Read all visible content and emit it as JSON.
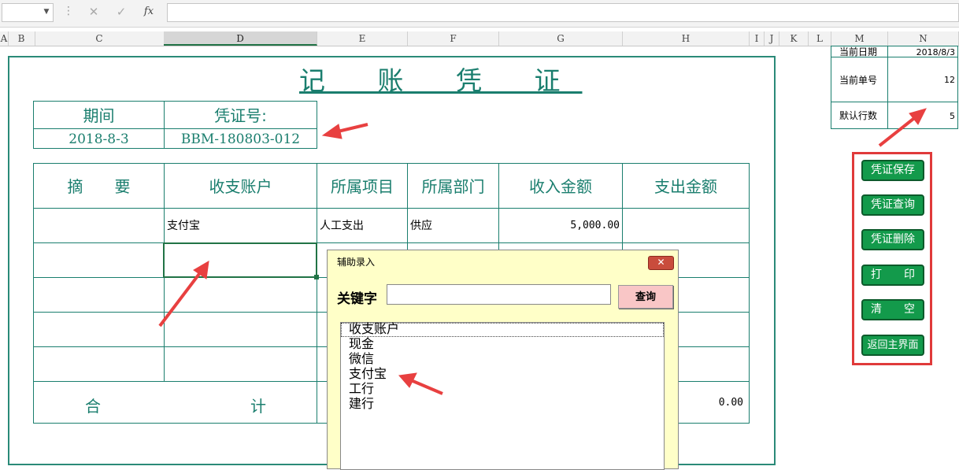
{
  "formula_bar": {
    "cancel_icon": "✕",
    "enter_icon": "✓",
    "fx_label": "fx",
    "value": ""
  },
  "columns": [
    "A",
    "B",
    "C",
    "D",
    "E",
    "F",
    "G",
    "H",
    "I",
    "J",
    "K",
    "L",
    "M",
    "N"
  ],
  "voucher": {
    "title": "记 账 凭 证",
    "period_label": "期间",
    "voucher_no_label": "凭证号:",
    "period_value": "2018-8-3",
    "voucher_no_value": "BBM-180803-012",
    "headers": {
      "summary": "摘　　要",
      "account": "收支账户",
      "project": "所属项目",
      "department": "所属部门",
      "income": "收入金额",
      "expense": "支出金额"
    },
    "rows": [
      {
        "summary": "",
        "account": "支付宝",
        "project": "人工支出",
        "department": "供应",
        "income": "5,000.00",
        "expense": ""
      },
      {
        "summary": "",
        "account": "",
        "project": "",
        "department": "",
        "income": "",
        "expense": ""
      },
      {
        "summary": "",
        "account": "",
        "project": "",
        "department": "",
        "income": "",
        "expense": ""
      },
      {
        "summary": "",
        "account": "",
        "project": "",
        "department": "",
        "income": "",
        "expense": ""
      },
      {
        "summary": "",
        "account": "",
        "project": "",
        "department": "",
        "income": "",
        "expense": ""
      }
    ],
    "total_label_1": "合",
    "total_label_2": "计",
    "total_expense": "0.00"
  },
  "info": {
    "current_date_label": "当前日期",
    "current_date_value": "2018/8/3",
    "current_no_label": "当前单号",
    "current_no_value": "12",
    "default_rows_label": "默认行数",
    "default_rows_value": "5"
  },
  "buttons": {
    "save": "凭证保存",
    "query": "凭证查询",
    "delete": "凭证删除",
    "print": "打　　印",
    "clear": "清　　空",
    "back": "返回主界面"
  },
  "dialog": {
    "title": "辅助录入",
    "close_icon": "✕",
    "keyword_label": "关键字",
    "keyword_value": "",
    "query_button": "查询",
    "list_items": [
      "收支账户",
      "现金",
      "微信",
      "支付宝",
      "工行",
      "建行"
    ]
  },
  "colors": {
    "teal": "#1a7e6e",
    "button_green": "#139a4b",
    "annotation_red": "#e03a3a",
    "dialog_bg": "#ffffc8"
  }
}
